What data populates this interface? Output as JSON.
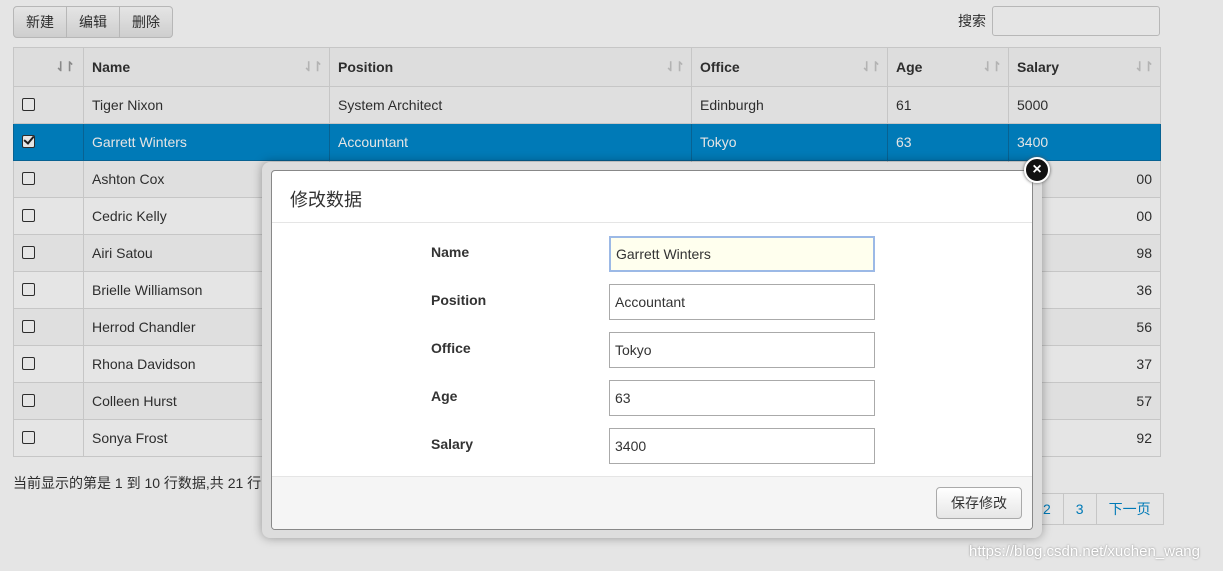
{
  "toolbar": {
    "new_label": "新建",
    "edit_label": "编辑",
    "delete_label": "删除"
  },
  "search": {
    "label": "搜索",
    "value": ""
  },
  "table": {
    "columns": [
      "Name",
      "Position",
      "Office",
      "Age",
      "Salary"
    ],
    "rows": [
      {
        "name": "Tiger Nixon",
        "position": "System Architect",
        "office": "Edinburgh",
        "age": "61",
        "salary": "5000",
        "checked": false
      },
      {
        "name": "Garrett Winters",
        "position": "Accountant",
        "office": "Tokyo",
        "age": "63",
        "salary": "3400",
        "checked": true
      },
      {
        "name": "Ashton Cox",
        "salary_partial": "00"
      },
      {
        "name": "Cedric Kelly",
        "salary_partial": "00"
      },
      {
        "name": "Airi Satou",
        "salary_partial": "98"
      },
      {
        "name": "Brielle Williamson",
        "salary_partial": "36"
      },
      {
        "name": "Herrod Chandler",
        "salary_partial": "56"
      },
      {
        "name": "Rhona Davidson",
        "salary_partial": "37"
      },
      {
        "name": "Colleen Hurst",
        "salary_partial": "57"
      },
      {
        "name": "Sonya Frost",
        "salary_partial": "92"
      }
    ]
  },
  "footer": {
    "info": "当前显示的第是 1 到 10 行数据,共 21 行"
  },
  "pagination": {
    "pages": [
      "2",
      "3"
    ],
    "next_label": "下一页"
  },
  "modal": {
    "title": "修改数据",
    "fields": [
      {
        "label": "Name",
        "value": "Garrett Winters"
      },
      {
        "label": "Position",
        "value": "Accountant"
      },
      {
        "label": "Office",
        "value": "Tokyo"
      },
      {
        "label": "Age",
        "value": "63"
      },
      {
        "label": "Salary",
        "value": "3400"
      }
    ],
    "save_label": "保存修改",
    "close_glyph": "×"
  },
  "watermark": "https://blog.csdn.net/xuchen_wang"
}
